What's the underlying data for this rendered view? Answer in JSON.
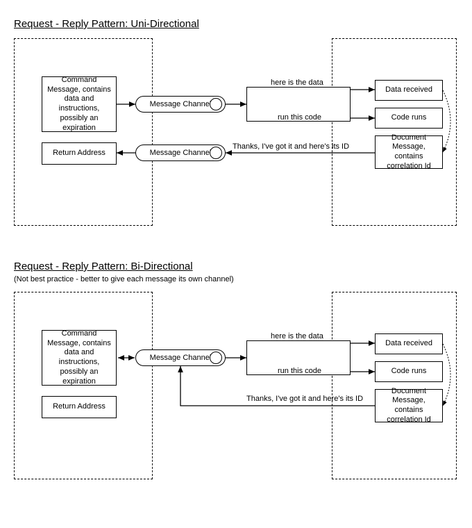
{
  "uni": {
    "title": "Request - Reply Pattern: Uni-Directional",
    "left": {
      "command": "Command Message, contains data and instructions, possibly an expiration",
      "return_addr": "Return Address"
    },
    "channel1": "Message Channel",
    "channel2": "Message Channel",
    "mid": {
      "data_label": "here is the data",
      "code_label": "run this code",
      "thanks_label": "Thanks, I've got it and here's its ID"
    },
    "right": {
      "data_received": "Data received",
      "code_runs": "Code runs",
      "doc_msg": "Document Message, contains correlation Id"
    }
  },
  "bi": {
    "title": "Request - Reply Pattern: Bi-Directional",
    "subtitle": "(Not best practice - better to give each message its own channel)",
    "left": {
      "command": "Command Message, contains data and instructions, possibly an expiration",
      "return_addr": "Return Address"
    },
    "channel1": "Message Channel",
    "mid": {
      "data_label": "here is the data",
      "code_label": "run this code",
      "thanks_label": "Thanks, I've got it and here's its ID"
    },
    "right": {
      "data_received": "Data received",
      "code_runs": "Code runs",
      "doc_msg": "Document Message, contains correlation Id"
    }
  }
}
